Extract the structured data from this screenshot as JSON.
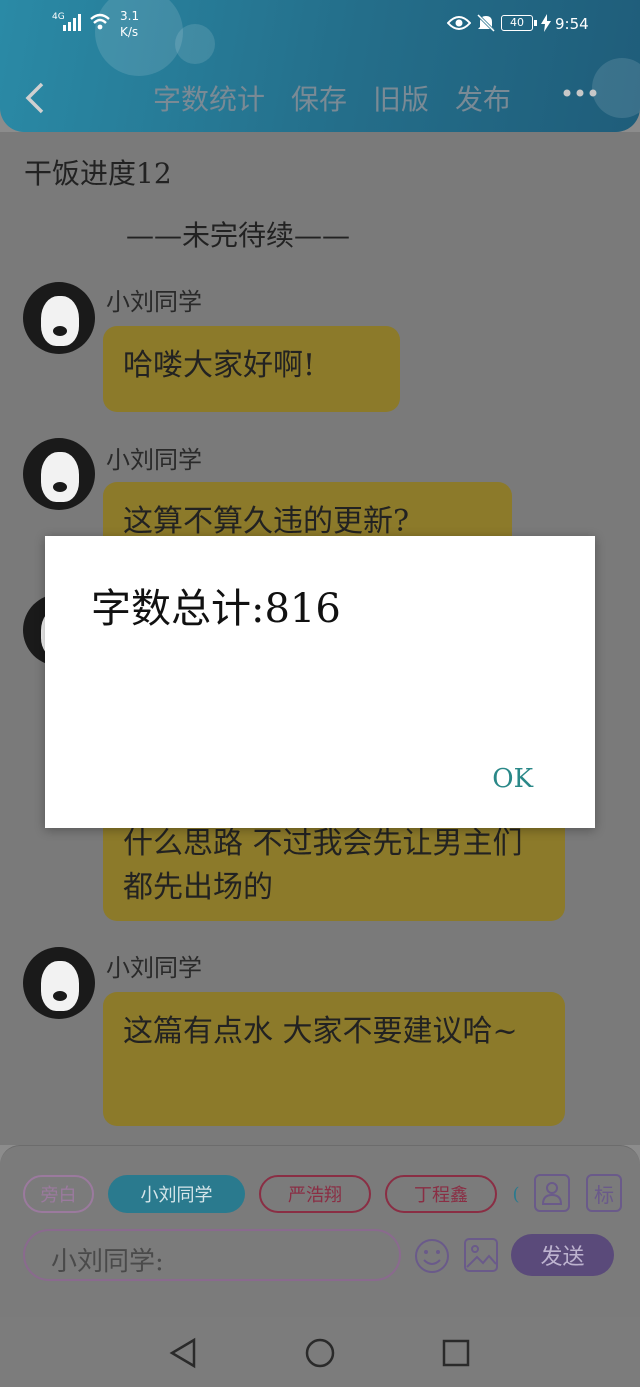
{
  "status_bar": {
    "network": "4G",
    "speed": "3.1",
    "speed_unit": "K/s",
    "battery": "40",
    "time": "9:54"
  },
  "app_bar": {
    "back_icon": "chevron-left-icon",
    "actions": [
      "字数统计",
      "保存",
      "旧版",
      "发布"
    ],
    "more_icon": "more-horizontal-icon"
  },
  "document": {
    "title": "干饭进度12",
    "subtitle": "——未完待续——"
  },
  "messages": [
    {
      "name": "小刘同学",
      "text": "哈喽大家好啊!"
    },
    {
      "name": "小刘同学",
      "text": "这算不算久违的更新?"
    },
    {
      "name": "",
      "text": "什么思路 不过我会先让男主们都先出场的"
    },
    {
      "name": "小刘同学",
      "text": "这篇有点水 大家不要建议哈~"
    }
  ],
  "role_chips": [
    {
      "label": "旁白",
      "color": "#b78ab8",
      "selected": false
    },
    {
      "label": "小刘同学",
      "color": "#2a8fa8",
      "selected": true
    },
    {
      "label": "严浩翔",
      "color": "#b23a55",
      "selected": false
    },
    {
      "label": "丁程鑫",
      "color": "#b23a55",
      "selected": false
    },
    {
      "label": "(",
      "color": "#2a8fa8",
      "selected": false
    }
  ],
  "toolbar_icons": [
    "person-icon",
    "tag-icon"
  ],
  "toolbar_tag_label": "标",
  "input": {
    "placeholder": "小刘同学:",
    "emoji_icon": "emoji-icon",
    "image_icon": "image-icon",
    "send_label": "发送"
  },
  "dialog": {
    "title": "字数总计:816",
    "ok_label": "OK"
  },
  "nav": [
    "back-triangle-icon",
    "home-circle-icon",
    "recents-square-icon"
  ],
  "colors": {
    "app_bar": "#2a8aa6",
    "bubble": "#8c7a2a",
    "send": "#6b5a8a",
    "ok": "#2a8888"
  }
}
